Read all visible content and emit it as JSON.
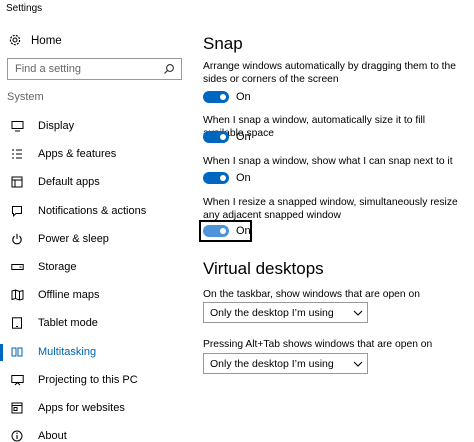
{
  "window": {
    "title": "Settings"
  },
  "sidebar": {
    "home_label": "Home",
    "search_placeholder": "Find a setting",
    "section_label": "System",
    "items": [
      {
        "label": "Display",
        "icon": "display-icon"
      },
      {
        "label": "Apps & features",
        "icon": "apps-list-icon"
      },
      {
        "label": "Default apps",
        "icon": "default-apps-icon"
      },
      {
        "label": "Notifications & actions",
        "icon": "notifications-icon"
      },
      {
        "label": "Power & sleep",
        "icon": "power-icon"
      },
      {
        "label": "Storage",
        "icon": "storage-icon"
      },
      {
        "label": "Offline maps",
        "icon": "map-icon"
      },
      {
        "label": "Tablet mode",
        "icon": "tablet-icon"
      },
      {
        "label": "Multitasking",
        "icon": "multitasking-icon",
        "active": true
      },
      {
        "label": "Projecting to this PC",
        "icon": "projecting-icon"
      },
      {
        "label": "Apps for websites",
        "icon": "apps-websites-icon"
      },
      {
        "label": "About",
        "icon": "info-icon"
      }
    ]
  },
  "main": {
    "snap": {
      "heading": "Snap",
      "settings": [
        {
          "desc": "Arrange windows automatically by dragging them to the sides or corners of the screen",
          "state": "On"
        },
        {
          "desc": "When I snap a window, automatically size it to fill available space",
          "state": "On"
        },
        {
          "desc": "When I snap a window, show what I can snap next to it",
          "state": "On"
        },
        {
          "desc": "When I resize a snapped window, simultaneously resize any adjacent snapped window",
          "state": "On"
        }
      ]
    },
    "virtual_desktops": {
      "heading": "Virtual desktops",
      "taskbar_label": "On the taskbar, show windows that are open on",
      "taskbar_value": "Only the desktop I’m using",
      "alttab_label": "Pressing Alt+Tab shows windows that are open on",
      "alttab_value": "Only the desktop I’m using"
    }
  },
  "colors": {
    "accent": "#0067c0",
    "active_text": "#0063b1"
  }
}
